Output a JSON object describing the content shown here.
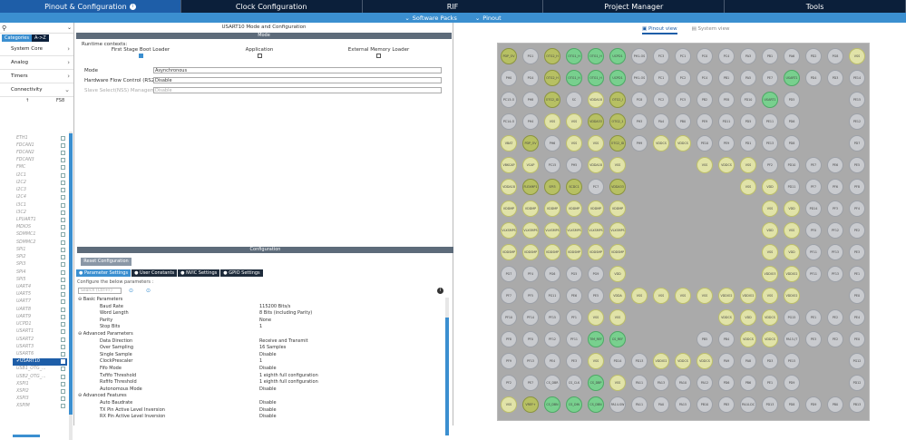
{
  "topTabs": [
    {
      "label": "Pinout & Configuration",
      "active": true
    },
    {
      "label": "Clock Configuration"
    },
    {
      "label": "RIF"
    },
    {
      "label": "Project Manager"
    },
    {
      "label": "Tools"
    }
  ],
  "subbar": {
    "software_packs": "Software Packs",
    "pinout": "Pinout"
  },
  "left": {
    "tab_categories": "Categories",
    "tab_az": "A->Z",
    "categories": [
      "System Core",
      "Analog",
      "Timers",
      "Connectivity"
    ],
    "fs_header": "FS8",
    "peripherals": [
      "ETH1",
      "FDCAN1",
      "FDCAN2",
      "FDCAN3",
      "FMC",
      "I2C1",
      "I2C2",
      "I2C3",
      "I2C4",
      "I3C1",
      "I3C2",
      "LPUART1",
      "MDIOS",
      "SDMMC1",
      "SDMMC2",
      "SPI1",
      "SPI2",
      "SPI3",
      "SPI4",
      "SPI5",
      "UART4",
      "UART5",
      "UART7",
      "UART8",
      "UART9",
      "UCPD1",
      "USART1",
      "USART2",
      "USART3",
      "USART6",
      "USART10",
      "USB1_OTG_...",
      "USB2_OTG_...",
      "XSPI1",
      "XSPI2",
      "XSPI3",
      "XSPIM"
    ],
    "selected": "USART10"
  },
  "mode": {
    "window_title": "USART10 Mode and Configuration",
    "section": "Mode",
    "runtime_label": "Runtime contexts:",
    "contexts": [
      "First Stage Boot Loader",
      "Application",
      "External Memory Loader"
    ],
    "fields": [
      {
        "label": "Mode",
        "value": "Asynchronous"
      },
      {
        "label": "Hardware Flow Control (RS232)",
        "value": "Disable"
      },
      {
        "label": "Slave Select(NSS) Management",
        "value": "Disable"
      }
    ]
  },
  "config": {
    "section": "Configuration",
    "reset": "Reset Configuration",
    "tabs": [
      "Parameter Settings",
      "User Constants",
      "NVIC Settings",
      "GPIO Settings"
    ],
    "prompt": "Configure the below parameters :",
    "search_placeholder": "Search (Ctrl+F)",
    "params": [
      {
        "k": "Basic Parameters",
        "v": "",
        "sec": true
      },
      {
        "k": "Baud Rate",
        "v": "115200 Bits/s"
      },
      {
        "k": "Word Length",
        "v": "8 Bits (including Parity)"
      },
      {
        "k": "Parity",
        "v": "None"
      },
      {
        "k": "Stop Bits",
        "v": "1"
      },
      {
        "k": "Advanced Parameters",
        "v": "",
        "sec": true
      },
      {
        "k": "Data Direction",
        "v": "Receive and Transmit"
      },
      {
        "k": "Over Sampling",
        "v": "16 Samples"
      },
      {
        "k": "Single Sample",
        "v": "Disable"
      },
      {
        "k": "ClockPrescaler",
        "v": "1"
      },
      {
        "k": "Fifo Mode",
        "v": "Disable"
      },
      {
        "k": "Txfifo Threshold",
        "v": "1 eighth full configuration"
      },
      {
        "k": "Rxfifo Threshold",
        "v": "1 eighth full configuration"
      },
      {
        "k": "Autonomous Mode",
        "v": "Disable"
      },
      {
        "k": "Advanced Features",
        "v": "",
        "sec": true
      },
      {
        "k": "Auto Baudrate",
        "v": "Disable"
      },
      {
        "k": "TX Pin Active Level Inversion",
        "v": "Disable"
      },
      {
        "k": "RX Pin Active Level Inversion",
        "v": "Disable"
      }
    ]
  },
  "right": {
    "pinout_view": "Pinout view",
    "system_view": "System view"
  },
  "pins": [
    [
      "PDP_OV",
      "PG1",
      "OTG2_H",
      "OTG1_H",
      "OTG1_H",
      "UCPD1",
      "PH1-OS",
      "PC3",
      "PC1",
      "PC0",
      "PC4",
      "PA3",
      "PB1",
      "PA6",
      "PD2",
      "PG8",
      "VSS"
    ],
    [
      "PH0",
      "PG4",
      "OTG2_H",
      "OTG1_H",
      "OTG1_H",
      "UCPD1",
      "PH1-OS",
      "PC1",
      "PC2",
      "PC4",
      "PB1",
      "PA5",
      "PE7",
      "USART1",
      "PD4",
      "PD3",
      "PE14"
    ],
    [
      "PC13-O",
      "PH8",
      "OTG2_ID",
      "SC",
      "VDDA18",
      "OTG2_I",
      "PC8",
      "PC2",
      "PC5",
      "PB2",
      "PE8",
      "PD10",
      "USART1",
      "PD5",
      "PE15"
    ],
    [
      "PC14-O",
      "PH4",
      "VSS",
      "VSS",
      "VDDA33",
      "OTG2_1",
      "PH3",
      "PA4",
      "PB0",
      "PE9",
      "PD11",
      "PD5",
      "PE11",
      "PD6",
      "PE12"
    ],
    [
      "VBAT",
      "PDP_OV",
      "PH6",
      "VSS",
      "VSS",
      "OTG2_ID",
      "PH9",
      "VDDCS",
      "VDDCS",
      "PE10",
      "PE9",
      "PD1",
      "PE13",
      "PD8",
      "PD7"
    ],
    [
      "VBKCAP",
      "VCAP",
      "PC15",
      "PH5",
      "VDDA18",
      "VSS",
      "VSS",
      "VDDCS",
      "VSS",
      "PF2",
      "PD10",
      "PE7",
      "PE6",
      "PE5"
    ],
    [
      "VDDA18",
      "FLEXMP1",
      "SPI3",
      "SCDC1",
      "PC7",
      "VDDA33",
      "VSS",
      "VDD",
      "PD11",
      "PF7",
      "PF6",
      "PF8"
    ],
    [
      "VDDMP",
      "VDDMP",
      "VDDMP",
      "VDDMP",
      "VDDMP",
      "VDDMP",
      "VSS",
      "VDD",
      "PD14",
      "PF3",
      "PF4"
    ],
    [
      "VLXSMPS",
      "VLXSMPS",
      "VLXSMPS",
      "VLXSMPS",
      "VLXSMPS",
      "VLXSMPS",
      "VDD",
      "VSS",
      "PF0",
      "PF12",
      "PE2"
    ],
    [
      "VDDSMP",
      "VDDSMP",
      "VDDSMP",
      "VDDSMP",
      "VDDSMP",
      "VDDSMP",
      "VSS",
      "VDD",
      "PF11",
      "PF13",
      "PE3"
    ],
    [
      "PG7",
      "PF4",
      "PG6",
      "PG5",
      "PG9",
      "VDD",
      "VDDIO3",
      "VDDIO2",
      "PF11",
      "PF13",
      "PE1"
    ],
    [
      "PF7",
      "PF5",
      "PG11",
      "PE6",
      "PE5",
      "VDDA",
      "VSS",
      "VSS",
      "VSS",
      "VSS",
      "VDDIO2",
      "VDDIO2",
      "VSS",
      "VDDIO2",
      "PE0"
    ],
    [
      "PF10",
      "PF14",
      "PF15",
      "PF1",
      "VSS",
      "VSS",
      "VDDCS",
      "VDD",
      "VDDCS",
      "PG15",
      "PE1",
      "PE2",
      "PE4"
    ],
    [
      "PF8",
      "PF0",
      "PF12",
      "PF11",
      "TIM_REF",
      "CS_REF",
      "PB5",
      "PB4",
      "VDDCS",
      "VDDCS",
      "PA15-JT",
      "PE3",
      "PE2",
      "PE0"
    ],
    [
      "PF9",
      "PF13",
      "PE4",
      "PE3",
      "VSS",
      "PD14",
      "PD13",
      "VDDIO2",
      "VDDCS",
      "VDDCS",
      "PA9",
      "PA8",
      "PD3",
      "PE15",
      "PG12"
    ],
    [
      "PF2",
      "PE7",
      "CS_DBR",
      "CS_CLK",
      "CS_DBP",
      "VSS",
      "PA11",
      "PA13",
      "PA10",
      "PA12",
      "PD6",
      "PB6",
      "PE1",
      "PD9",
      "PD12"
    ],
    [
      "VSS",
      "VREF+",
      "CS_DBN",
      "CS_DIN",
      "CS_DBN",
      "PA14-SW",
      "PA11",
      "PA0",
      "PA15",
      "PB10",
      "PB3",
      "PA10-DC",
      "PD13",
      "PD8",
      "PD9",
      "PB0",
      "PB13"
    ]
  ]
}
